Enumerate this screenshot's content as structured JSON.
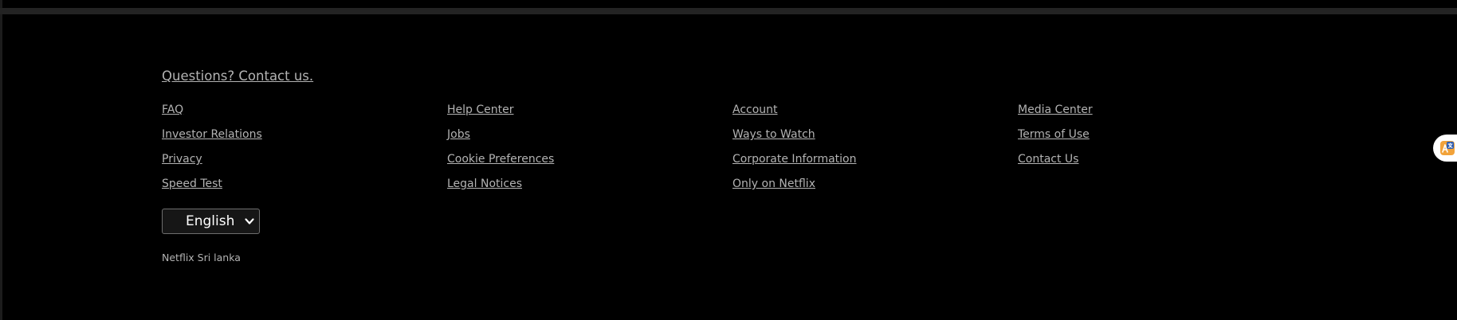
{
  "footer": {
    "contact_label": "Questions? Contact us.",
    "columns": [
      {
        "links": [
          {
            "label": "FAQ"
          },
          {
            "label": "Investor Relations"
          },
          {
            "label": "Privacy"
          },
          {
            "label": "Speed Test"
          }
        ]
      },
      {
        "links": [
          {
            "label": "Help Center"
          },
          {
            "label": "Jobs"
          },
          {
            "label": "Cookie Preferences"
          },
          {
            "label": "Legal Notices"
          }
        ]
      },
      {
        "links": [
          {
            "label": "Account"
          },
          {
            "label": "Ways to Watch"
          },
          {
            "label": "Corporate Information"
          },
          {
            "label": "Only on Netflix"
          }
        ]
      },
      {
        "links": [
          {
            "label": "Media Center"
          },
          {
            "label": "Terms of Use"
          },
          {
            "label": "Contact Us"
          }
        ]
      }
    ],
    "language_select": {
      "value": "English",
      "icon": "chevron-down-icon"
    },
    "country_label": "Netflix Sri lanka"
  },
  "extension": {
    "icon": "translate-icon"
  },
  "colors": {
    "background": "#000000",
    "link": "#b3b3b3",
    "divider": "#232323"
  }
}
